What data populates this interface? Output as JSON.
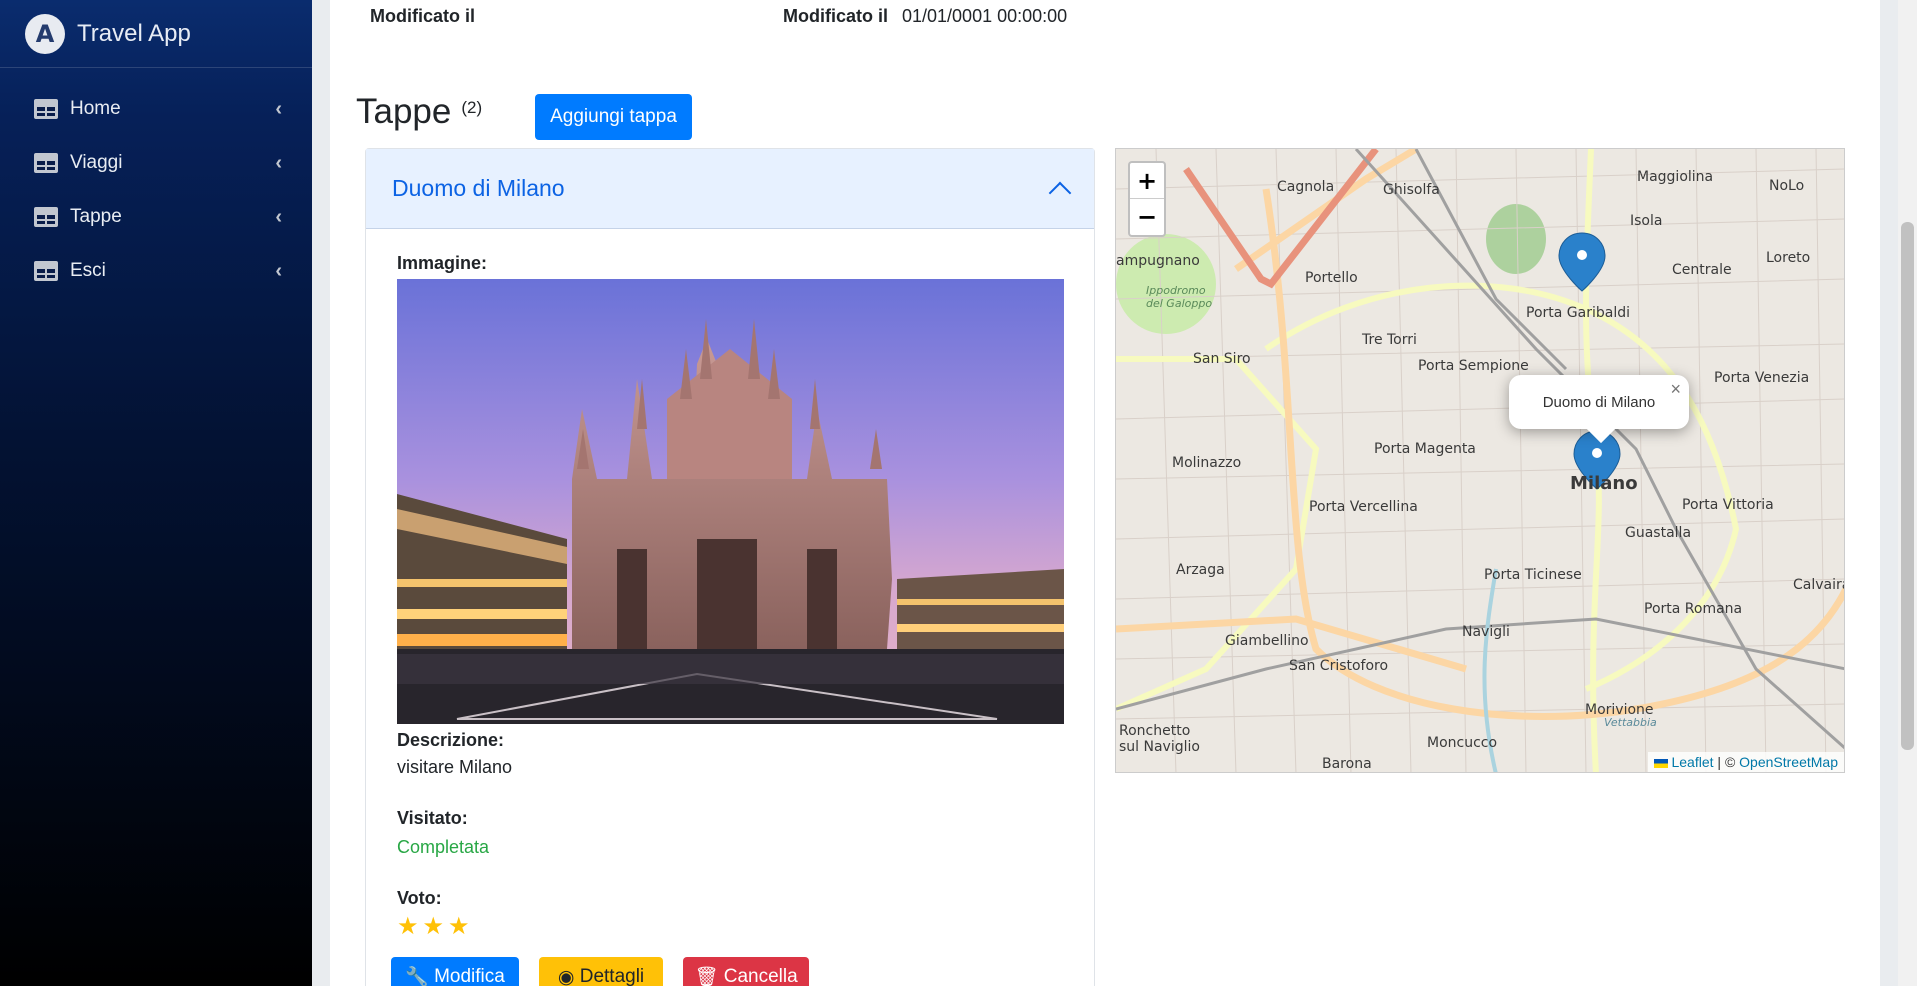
{
  "app": {
    "name": "Travel App"
  },
  "sidebar": {
    "items": [
      {
        "label": "Home"
      },
      {
        "label": "Viaggi"
      },
      {
        "label": "Tappe"
      },
      {
        "label": "Esci"
      }
    ]
  },
  "modified": {
    "label_left": "Modificato il",
    "label_right": "Modificato il",
    "value": "01/01/0001 00:00:00"
  },
  "tappe": {
    "title": "Tappe",
    "count": "(2)",
    "add_button": "Aggiungi tappa"
  },
  "stop": {
    "title": "Duomo di Milano",
    "image_label": "Immagine:",
    "description_label": "Descrizione:",
    "description": "visitare Milano",
    "visited_label": "Visitato:",
    "visited_value": "Completata",
    "rating_label": "Voto:",
    "rating": 3,
    "buttons": {
      "edit": "Modifica",
      "details": "Dettagli",
      "delete": "Cancella"
    }
  },
  "map": {
    "zoom_in": "+",
    "zoom_out": "−",
    "popup_text": "Duomo di Milano",
    "popup_close": "×",
    "attribution_leaflet": "Leaflet",
    "attribution_sep": " | © ",
    "attribution_osm": "OpenStreetMap",
    "labels": [
      "Cagnola",
      "Ghisolfa",
      "Maggiolina",
      "NoLo",
      "Isola",
      "Loreto",
      "Centrale",
      "Portello",
      "Porta Garibaldi",
      "Ippodromo del Galoppo",
      "Tre Torri",
      "San Siro",
      "Porta Sempione",
      "Porta Venezia",
      "Porta Magenta",
      "Molinazzo",
      "Milano",
      "Porta Vercellina",
      "Porta Vittoria",
      "Guastalla",
      "Arzaga",
      "Porta Ticinese",
      "Calvairate",
      "Porta Romana",
      "Navigli",
      "Giambellino",
      "San Cristoforo",
      "Morivione",
      "Ronchetto sul Naviglio",
      "Moncucco",
      "Barona",
      "Vettabbia",
      "ampugnano"
    ]
  },
  "colors": {
    "primary": "#007bff",
    "warning": "#ffc107",
    "danger": "#dc3545",
    "success": "#28a745",
    "accordion_header": "#e7f1ff"
  }
}
